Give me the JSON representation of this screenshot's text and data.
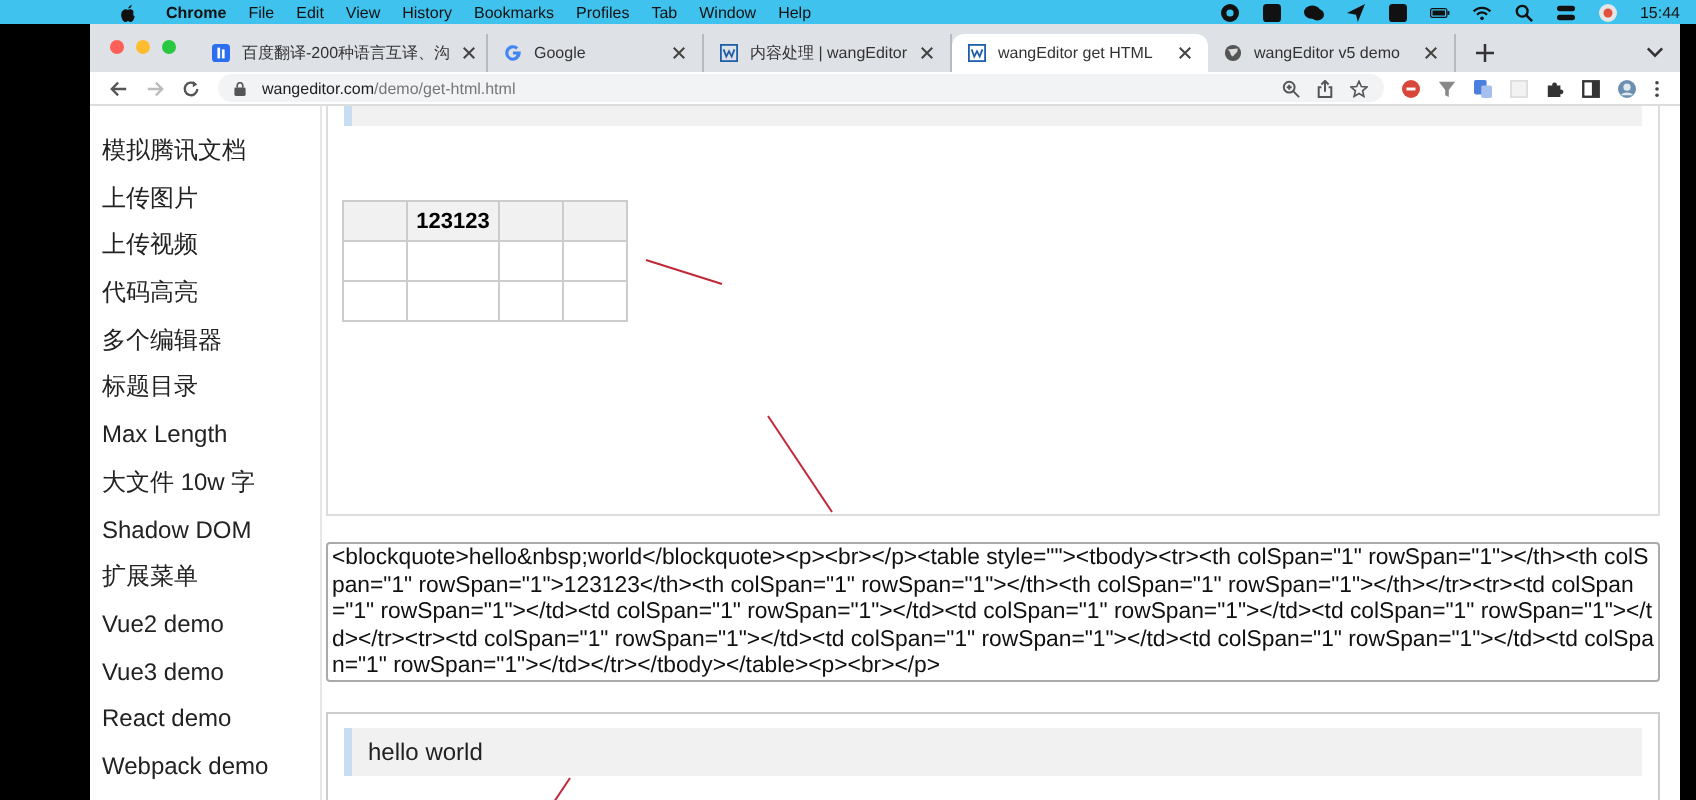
{
  "menu_bar": {
    "app": "Chrome",
    "items": [
      "File",
      "Edit",
      "View",
      "History",
      "Bookmarks",
      "Profiles",
      "Tab",
      "Window",
      "Help"
    ],
    "clock": "15:44"
  },
  "tabs": [
    {
      "title": "百度翻译-200种语言互译、沟",
      "selected": false
    },
    {
      "title": "Google",
      "selected": false
    },
    {
      "title": "内容处理 | wangEditor",
      "selected": false
    },
    {
      "title": "wangEditor get HTML",
      "selected": true
    },
    {
      "title": "wangEditor v5 demo",
      "selected": false
    }
  ],
  "address_bar": {
    "domain": "wangeditor.com",
    "path": "/demo/get-html.html"
  },
  "sidebar": {
    "items": [
      "模拟腾讯文档",
      "上传图片",
      "上传视频",
      "代码高亮",
      "多个编辑器",
      "标题目录",
      "Max Length",
      "大文件 10w 字",
      "Shadow DOM",
      "扩展菜单",
      "Vue2 demo",
      "Vue3 demo",
      "React demo",
      "Webpack demo"
    ]
  },
  "editor": {
    "table": {
      "header": [
        {
          "kind": "blank"
        },
        {
          "kind": "text",
          "text": "123123"
        },
        {
          "kind": "blank"
        },
        {
          "kind": "blank"
        }
      ],
      "rows": [
        [
          null,
          null,
          null,
          null
        ],
        [
          null,
          null,
          null,
          null
        ]
      ]
    }
  },
  "html_output": "<blockquote>hello&nbsp;world</blockquote><p><br></p><table style=\"\"><tbody><tr><th colSpan=\"1\" rowSpan=\"1\"></th><th colSpan=\"1\" rowSpan=\"1\">123123</th><th colSpan=\"1\" rowSpan=\"1\"></th><th colSpan=\"1\" rowSpan=\"1\"></th></tr><tr><td colSpan=\"1\" rowSpan=\"1\"></td><td colSpan=\"1\" rowSpan=\"1\"></td><td colSpan=\"1\" rowSpan=\"1\"></td><td colSpan=\"1\" rowSpan=\"1\"></td></tr><tr><td colSpan=\"1\" rowSpan=\"1\"></td><td colSpan=\"1\" rowSpan=\"1\"></td><td colSpan=\"1\" rowSpan=\"1\"></td><td colSpan=\"1\" rowSpan=\"1\"></td></tr></tbody></table><p><br></p>",
  "preview": {
    "blockquote": "hello world"
  }
}
